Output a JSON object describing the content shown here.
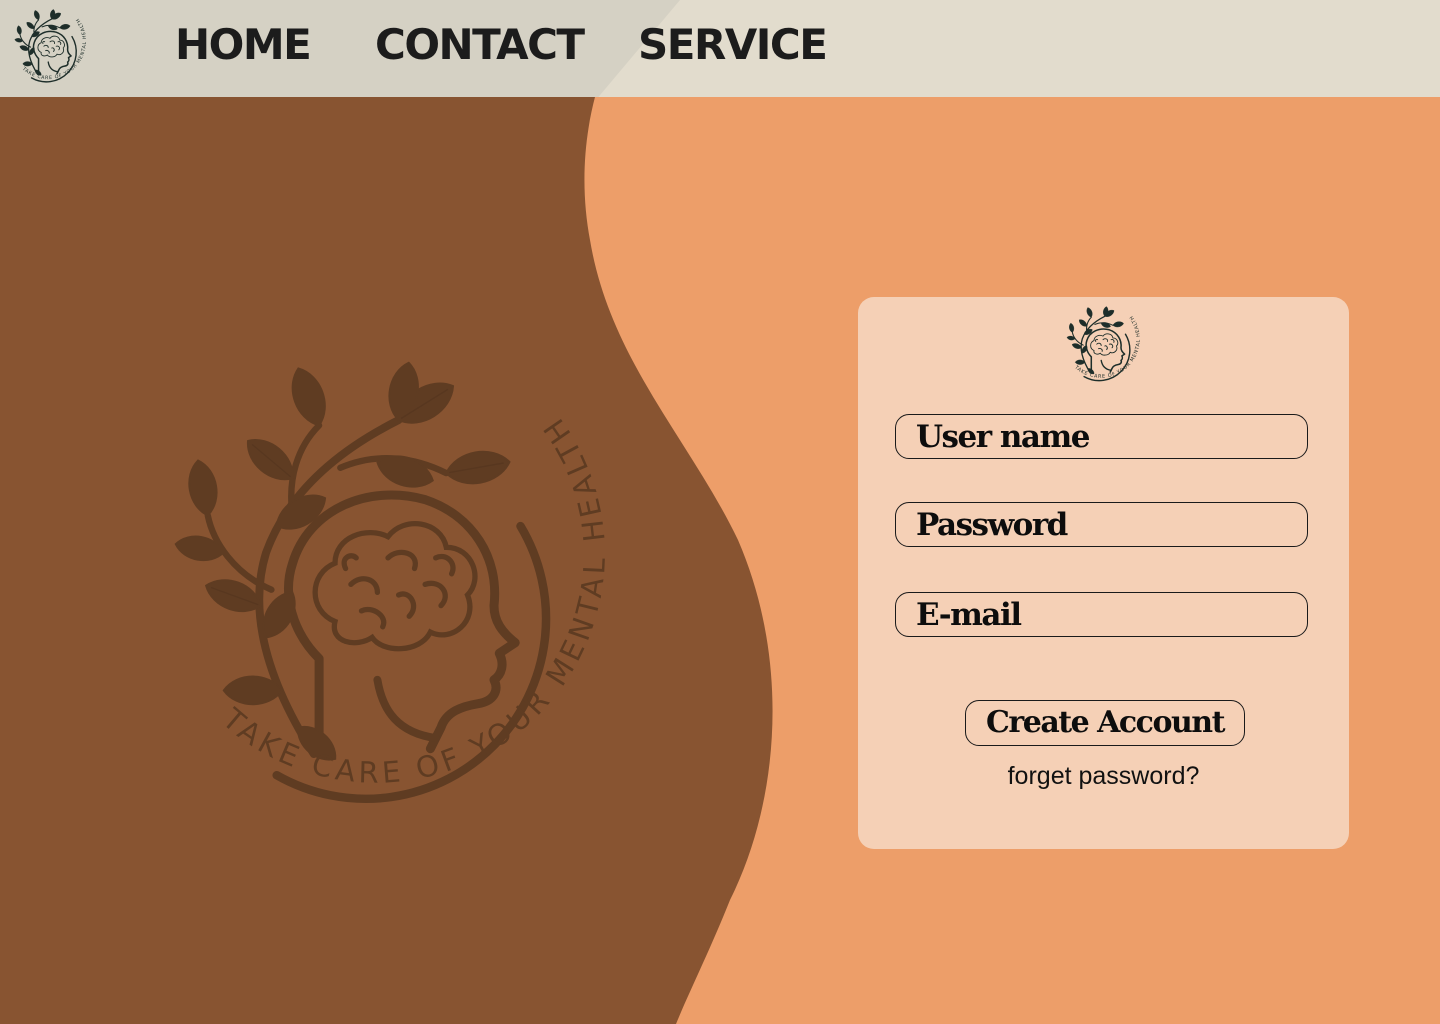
{
  "colors": {
    "page_background": "#ED9E69",
    "wave_brown": "#885431",
    "nav_background": "#E2DCCD",
    "card_background": "#F5D0B6",
    "emblem_ink": "#1E2E2A"
  },
  "brand": {
    "logo_icon": "brain-head-leaves-emblem-icon",
    "logo_text": "TAKE CARE OF YOUR MENTAL HEALTH"
  },
  "nav": {
    "items": [
      {
        "label": "HOME"
      },
      {
        "label": "CONTACT"
      },
      {
        "label": "SERVICE"
      }
    ]
  },
  "login_form": {
    "fields": [
      {
        "label": "User name"
      },
      {
        "label": "Password"
      },
      {
        "label": "E-mail"
      }
    ],
    "submit_label": "Create Account",
    "forgot_link": "forget password?"
  }
}
